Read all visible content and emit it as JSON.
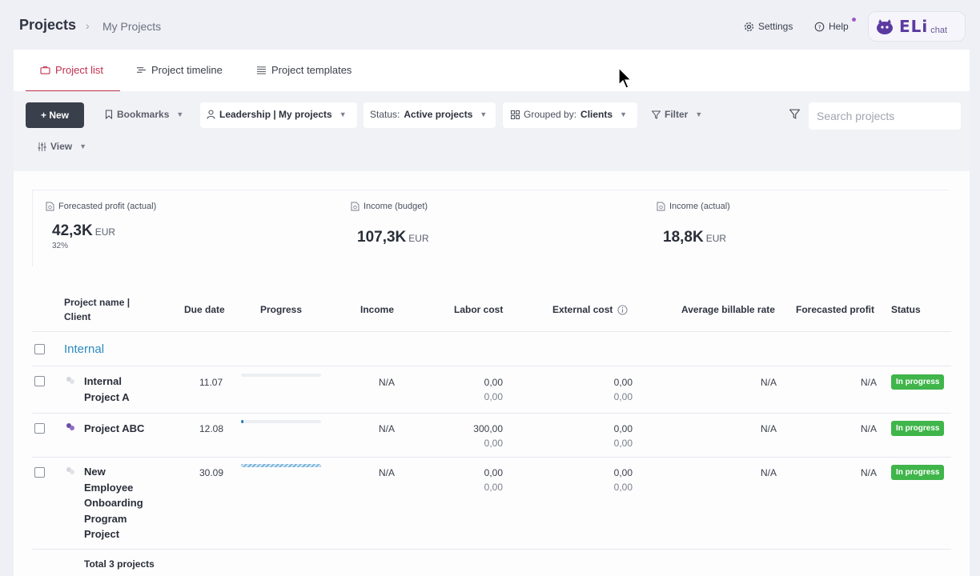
{
  "breadcrumb": {
    "title": "Projects",
    "separator": "›",
    "current": "My Projects"
  },
  "header": {
    "settings_label": "Settings",
    "help_label": "Help",
    "assistant_logo": "ELi",
    "assistant_sub": "chat"
  },
  "tabs": [
    {
      "label": "Project list",
      "icon": "briefcase-icon",
      "active": true
    },
    {
      "label": "Project timeline",
      "icon": "timeline-icon",
      "active": false
    },
    {
      "label": "Project templates",
      "icon": "list-icon",
      "active": false
    }
  ],
  "toolbar": {
    "new_label": "+ New",
    "bookmarks_label": "Bookmarks",
    "leadership_label": "Leadership | My projects",
    "status_prefix": "Status:",
    "status_value": "Active projects",
    "grouped_prefix": "Grouped by:",
    "grouped_value": "Clients",
    "filter_label": "Filter",
    "view_label": "View",
    "search_placeholder": "Search projects"
  },
  "kpis": [
    {
      "label": "Forecasted profit (actual)",
      "value": "42,3K",
      "unit": "EUR",
      "sub": "32%"
    },
    {
      "label": "Income (budget)",
      "value": "107,3K",
      "unit": "EUR",
      "sub": ""
    },
    {
      "label": "Income (actual)",
      "value": "18,8K",
      "unit": "EUR",
      "sub": ""
    }
  ],
  "table": {
    "headers": {
      "name": "Project name |",
      "name2": "Client",
      "due": "Due date",
      "progress": "Progress",
      "income": "Income",
      "labor": "Labor cost",
      "external": "External cost",
      "rate": "Average billable rate",
      "profit": "Forecasted profit",
      "status": "Status"
    },
    "group": "Internal",
    "rows": [
      {
        "name_lines": [
          "Internal",
          "Project A"
        ],
        "due": "11.07",
        "progress": 0,
        "income": "N/A",
        "labor": "0,00",
        "labor_sub": "0,00",
        "external": "0,00",
        "external_sub": "0,00",
        "rate": "N/A",
        "profit": "N/A",
        "status": "In progress"
      },
      {
        "name_lines": [
          "Project ABC"
        ],
        "due": "12.08",
        "progress": 0.03,
        "income": "N/A",
        "labor": "300,00",
        "labor_sub": "0,00",
        "external": "0,00",
        "external_sub": "0,00",
        "rate": "N/A",
        "profit": "N/A",
        "status": "In progress"
      },
      {
        "name_lines": [
          "New",
          "Employee",
          "Onboarding",
          "Program",
          "Project"
        ],
        "due": "30.09",
        "progress": 1,
        "income": "N/A",
        "labor": "0,00",
        "labor_sub": "0,00",
        "external": "0,00",
        "external_sub": "0,00",
        "rate": "N/A",
        "profit": "N/A",
        "status": "In progress"
      }
    ],
    "total": "Total 3 projects"
  },
  "colors": {
    "accent": "#c0304d",
    "primary_dark": "#3a3f4c",
    "group_link": "#2b8bbf",
    "status_green": "#3fb54a",
    "progress_blue": "#2e7fb8"
  }
}
